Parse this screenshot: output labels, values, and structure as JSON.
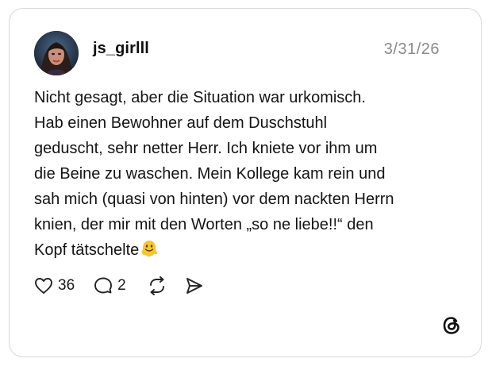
{
  "post": {
    "username": "js_girlll",
    "timestamp": "3/31/26",
    "text": "Nicht gesagt, aber die Situation war urkomisch.\nHab einen Bewohner auf dem Duschstuhl\ngeduscht, sehr netter Herr. Ich kniete vor ihm um\ndie Beine zu waschen. Mein Kollege kam rein und\nsah mich (quasi von hinten) vor dem nackten Herrn\nknien, der mir mit den Worten „so ne liebe!!“ den\nKopf tätschelte",
    "trailing_emoji": "melting-face-emoji"
  },
  "actions": {
    "likes": "36",
    "replies": "2",
    "like_icon": "heart-icon",
    "reply_icon": "comment-bubble-icon",
    "repost_icon": "repost-icon",
    "share_icon": "send-icon"
  },
  "branding": {
    "logo_icon": "threads-logo-icon"
  },
  "colors": {
    "card_border": "#d9d9d9",
    "timestamp": "#8a8a8a",
    "emoji_yellow": "#f7c52d"
  }
}
